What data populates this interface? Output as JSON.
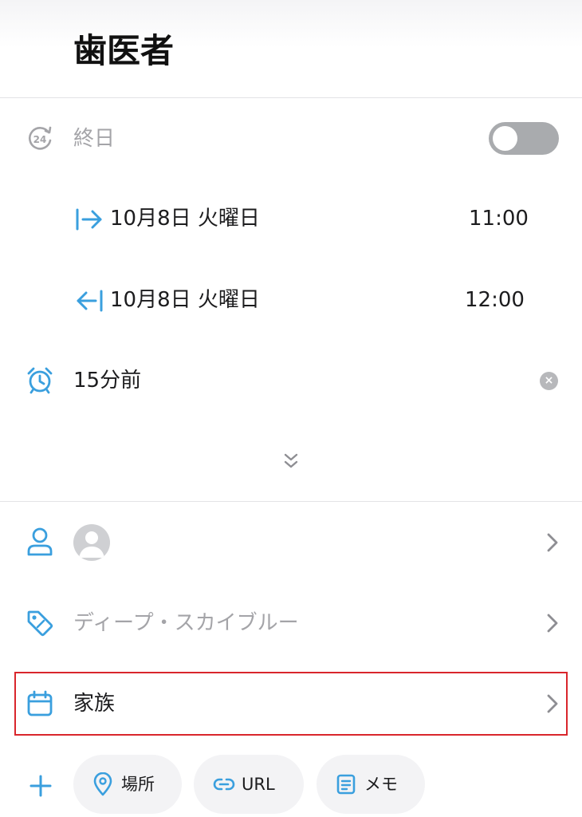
{
  "header": {
    "title": "歯医者"
  },
  "all_day": {
    "label": "終日",
    "enabled": false
  },
  "start": {
    "date": "10月8日 火曜日",
    "time": "11:00"
  },
  "end": {
    "date": "10月8日 火曜日",
    "time": "12:00"
  },
  "alarm": {
    "label": "15分前",
    "clear_symbol": "×"
  },
  "color": {
    "label": "ディープ・スカイブルー"
  },
  "calendar": {
    "label": "家族"
  },
  "attachments": {
    "location_label": "場所",
    "url_label": "URL",
    "memo_label": "メモ"
  },
  "colors": {
    "accent": "#3a9fde",
    "muted_text": "#a4a4a8",
    "highlight": "#d9262c"
  }
}
